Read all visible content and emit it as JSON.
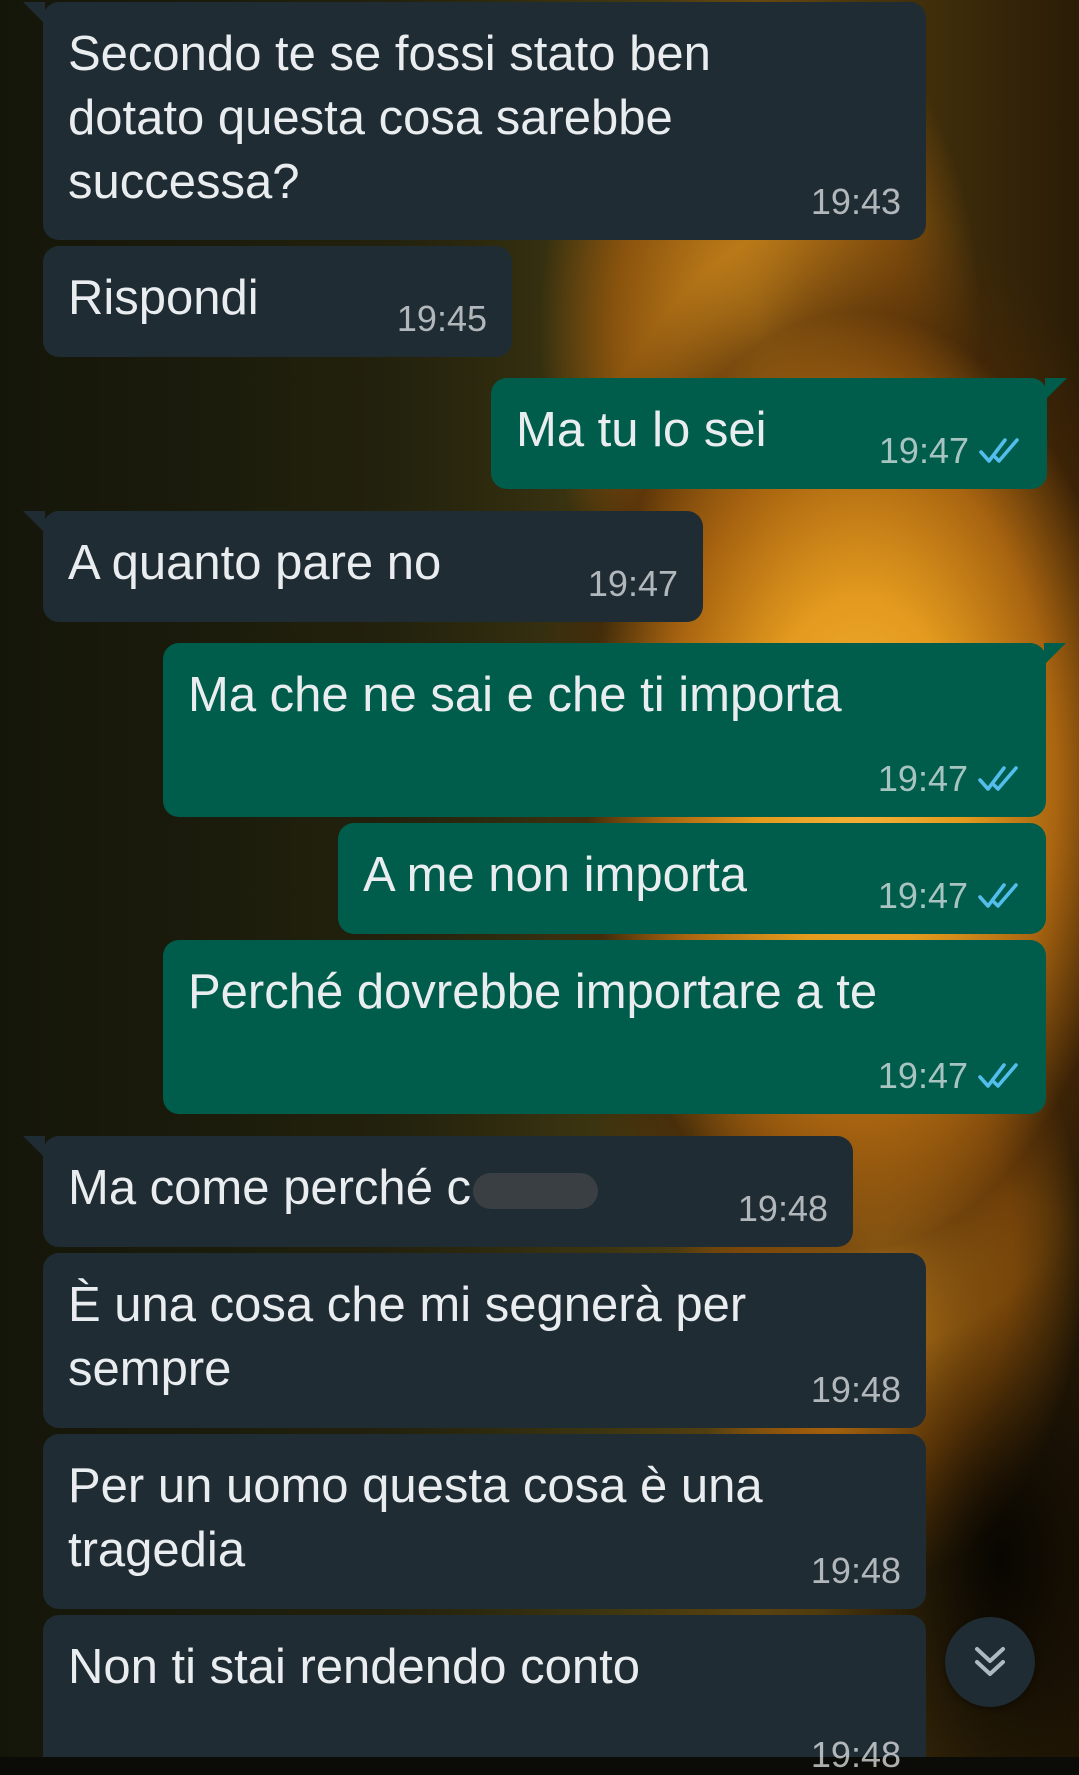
{
  "colors": {
    "incoming_bubble": "#202c33",
    "outgoing_bubble": "#005c4b",
    "text": "#e9edef",
    "read_tick": "#53bdeb"
  },
  "messages": [
    {
      "direction": "in",
      "text": "Secondo te se fossi stato ben\ndotato questa cosa sarebbe\nsuccessa?",
      "time": "19:43"
    },
    {
      "direction": "in",
      "text": "Rispondi",
      "time": "19:45"
    },
    {
      "direction": "out",
      "text": "Ma tu lo sei",
      "time": "19:47",
      "status": "read"
    },
    {
      "direction": "in",
      "text": "A quanto pare no",
      "time": "19:47"
    },
    {
      "direction": "out",
      "text": "Ma che ne sai e che ti importa",
      "time": "19:47",
      "status": "read"
    },
    {
      "direction": "out",
      "text": "A me non importa",
      "time": "19:47",
      "status": "read"
    },
    {
      "direction": "out",
      "text": "Perché dovrebbe importare a te",
      "time": "19:47",
      "status": "read"
    },
    {
      "direction": "in",
      "text": "Ma come perché c",
      "time": "19:48",
      "redacted": true
    },
    {
      "direction": "in",
      "text": "È una cosa che mi segnerà per\nsempre",
      "time": "19:48"
    },
    {
      "direction": "in",
      "text": "Per un uomo questa cosa è una\ntragedia",
      "time": "19:48"
    },
    {
      "direction": "in",
      "text": "Non ti stai rendendo conto",
      "time": "19:48"
    }
  ],
  "icons": {
    "read_receipt": "double-check-icon",
    "scroll_down": "double-chevron-down-icon"
  }
}
